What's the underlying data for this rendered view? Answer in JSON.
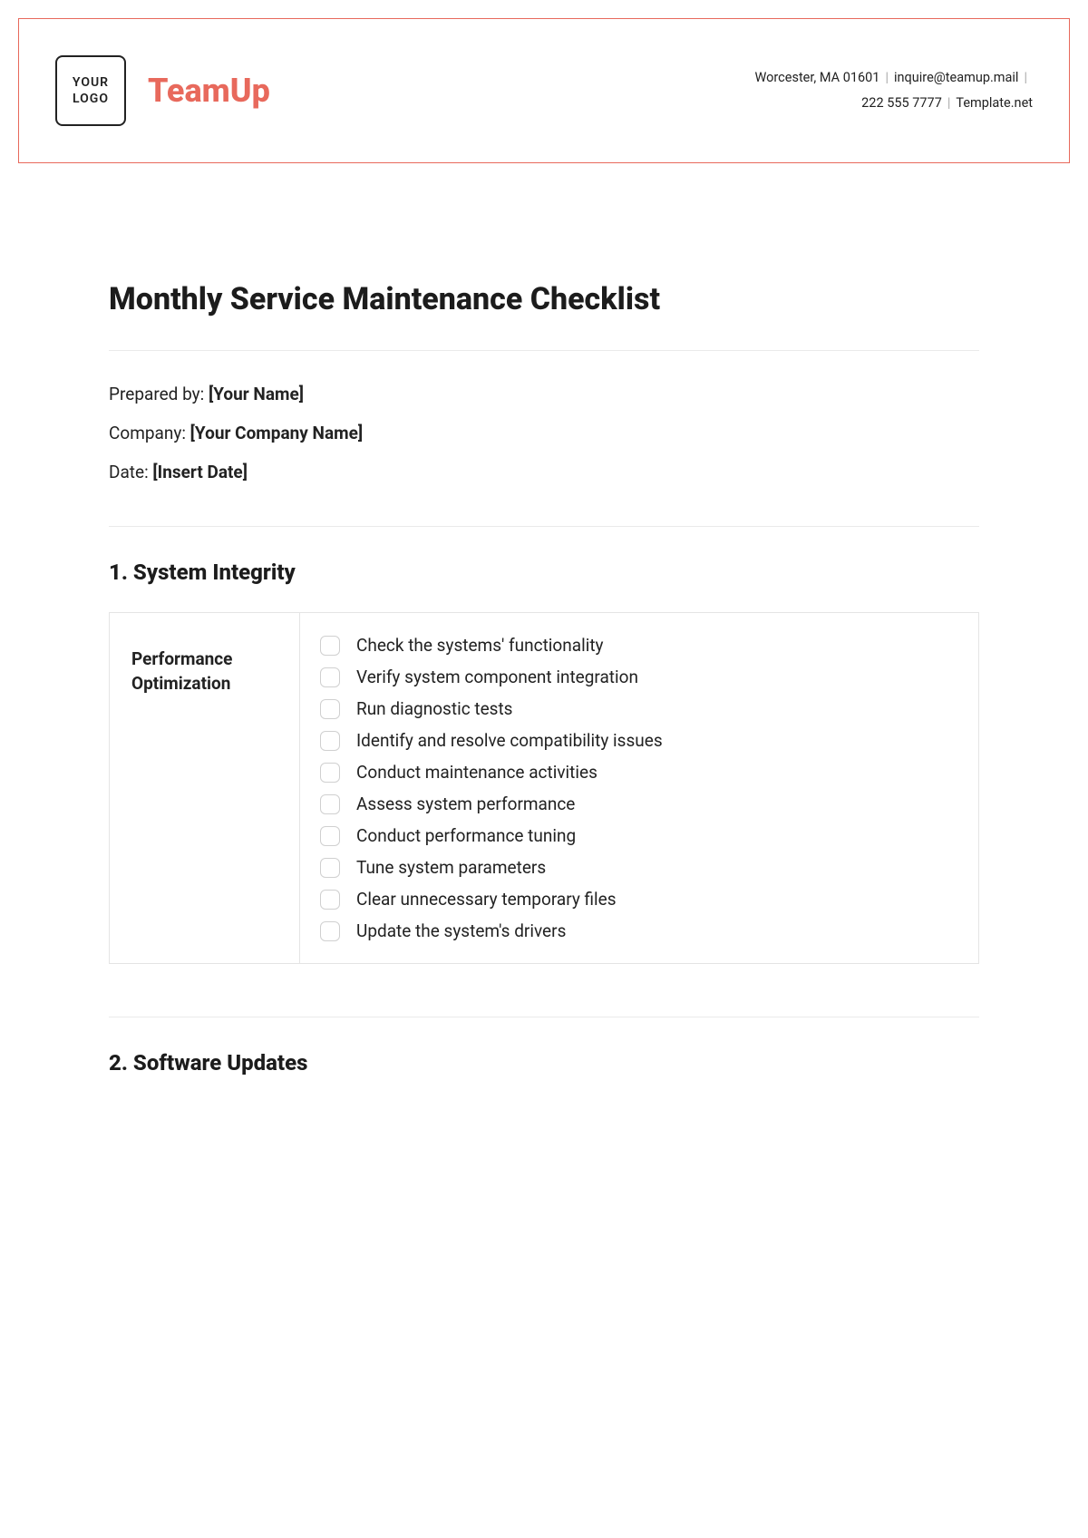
{
  "header": {
    "logo_line1": "YOUR",
    "logo_line2": "LOGO",
    "brand": "TeamUp",
    "addr": "Worcester, MA 01601",
    "email": "inquire@teamup.mail",
    "phone": "222 555 7777",
    "site": "Template.net"
  },
  "title": "Monthly Service Maintenance Checklist",
  "meta": {
    "prep_label": "Prepared by: ",
    "prep_val": "[Your Name]",
    "company_label": "Company: ",
    "company_val": "[Your Company Name]",
    "date_label": "Date: ",
    "date_val": "[Insert Date]"
  },
  "sections": [
    {
      "heading": "1. System Integrity",
      "category": "Performance Optimization",
      "items": [
        "Check the systems' functionality",
        "Verify system component integration",
        "Run diagnostic tests",
        "Identify and resolve compatibility issues",
        "Conduct maintenance activities",
        "Assess system performance",
        "Conduct performance tuning",
        "Tune system parameters",
        "Clear unnecessary temporary files",
        "Update the system's drivers"
      ]
    },
    {
      "heading": "2. Software Updates"
    }
  ]
}
